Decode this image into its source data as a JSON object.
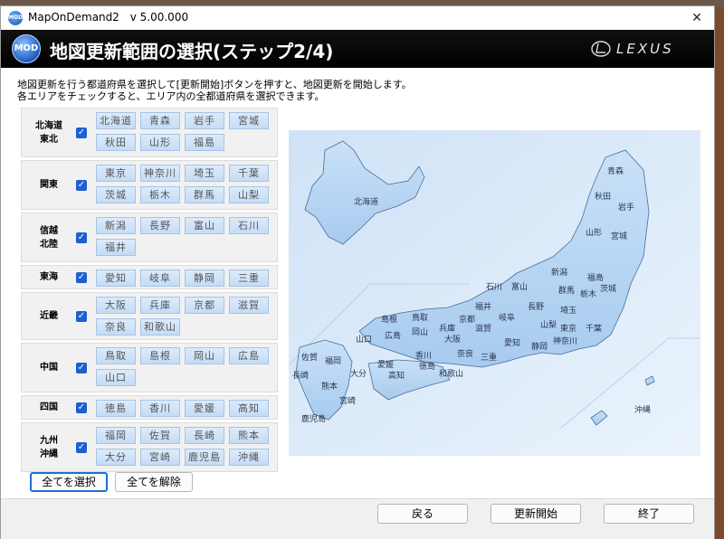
{
  "window": {
    "title": "MapOnDemand2",
    "version": "v 5.00.000",
    "close_icon": "✕",
    "app_icon_text": "MOD"
  },
  "banner": {
    "logo_text": "MOD",
    "title": "地図更新範囲の選択(ステップ2/4)",
    "brand": "LEXUS"
  },
  "instructions": [
    "地図更新を行う都道府県を選択して[更新開始]ボタンを押すと、地図更新を開始します。",
    "各エリアをチェックすると、エリア内の全都道府県を選択できます。"
  ],
  "regions": [
    {
      "label": "北海道\n東北",
      "checked": true,
      "prefectures": [
        "北海道",
        "青森",
        "岩手",
        "宮城",
        "秋田",
        "山形",
        "福島"
      ]
    },
    {
      "label": "関東",
      "checked": true,
      "prefectures": [
        "東京",
        "神奈川",
        "埼玉",
        "千葉",
        "茨城",
        "栃木",
        "群馬",
        "山梨"
      ]
    },
    {
      "label": "信越\n北陸",
      "checked": true,
      "prefectures": [
        "新潟",
        "長野",
        "富山",
        "石川",
        "福井"
      ]
    },
    {
      "label": "東海",
      "checked": true,
      "prefectures": [
        "愛知",
        "岐阜",
        "静岡",
        "三重"
      ]
    },
    {
      "label": "近畿",
      "checked": true,
      "prefectures": [
        "大阪",
        "兵庫",
        "京都",
        "滋賀",
        "奈良",
        "和歌山"
      ]
    },
    {
      "label": "中国",
      "checked": true,
      "prefectures": [
        "鳥取",
        "島根",
        "岡山",
        "広島",
        "山口"
      ]
    },
    {
      "label": "四国",
      "checked": true,
      "prefectures": [
        "徳島",
        "香川",
        "愛媛",
        "高知"
      ]
    },
    {
      "label": "九州\n沖縄",
      "checked": true,
      "prefectures": [
        "福岡",
        "佐賀",
        "長崎",
        "熊本",
        "大分",
        "宮崎",
        "鹿児島",
        "沖縄"
      ]
    }
  ],
  "select_buttons": {
    "select_all": "全てを選択",
    "deselect_all": "全てを解除"
  },
  "footer": {
    "back": "戻る",
    "start_update": "更新開始",
    "exit": "終了"
  },
  "map_labels": [
    "青森",
    "秋田",
    "岩手",
    "山形",
    "宮城",
    "新潟",
    "福島",
    "北海道",
    "石川",
    "富山",
    "群馬",
    "栃木",
    "茨城",
    "福井",
    "長野",
    "埼玉",
    "山梨",
    "東京",
    "千葉",
    "神奈川",
    "静岡",
    "岐阜",
    "愛知",
    "滋賀",
    "京都",
    "三重",
    "奈良",
    "大阪",
    "兵庫",
    "和歌山",
    "鳥取",
    "島根",
    "岡山",
    "広島",
    "山口",
    "香川",
    "愛媛",
    "徳島",
    "高知",
    "福岡",
    "佐賀",
    "長崎",
    "大分",
    "熊本",
    "宮崎",
    "鹿児島",
    "沖縄"
  ],
  "colors": {
    "pref_button_bg": "#c5dcf5",
    "check_blue": "#1d5fd1",
    "map_land": "#b4d4f4",
    "map_sea": "#dbeaf8"
  }
}
